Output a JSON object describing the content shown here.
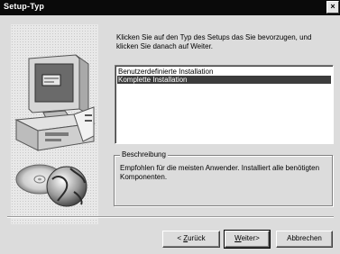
{
  "window": {
    "title": "Setup-Typ",
    "close_label": "×"
  },
  "instruction": "Klicken Sie auf den Typ des Setups das Sie bevorzugen, und klicken Sie danach auf Weiter.",
  "setup_types": [
    {
      "label": "Benutzerdefinierte Installation",
      "selected": false
    },
    {
      "label": "Komplette Installation",
      "selected": true
    }
  ],
  "description": {
    "legend": "Beschreibung",
    "text": "Empfohlen für die meisten Anwender. Installiert alle benötigten Komponenten."
  },
  "buttons": {
    "back": {
      "prefix": "< ",
      "accel": "Z",
      "rest": "urück"
    },
    "next": {
      "accel": "W",
      "rest": "eiter>"
    },
    "cancel": "Abbrechen"
  },
  "artwork": {
    "icons": [
      "monitor-icon",
      "computer-tower-icon",
      "cd-disc-icon",
      "globe-icon"
    ]
  }
}
